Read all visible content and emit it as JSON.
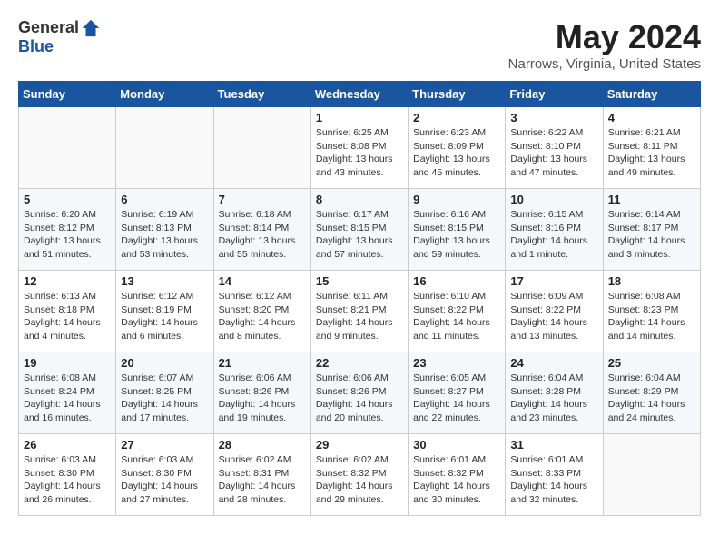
{
  "header": {
    "logo_general": "General",
    "logo_blue": "Blue",
    "month_title": "May 2024",
    "location": "Narrows, Virginia, United States"
  },
  "calendar": {
    "days_of_week": [
      "Sunday",
      "Monday",
      "Tuesday",
      "Wednesday",
      "Thursday",
      "Friday",
      "Saturday"
    ],
    "weeks": [
      [
        {
          "day": "",
          "info": ""
        },
        {
          "day": "",
          "info": ""
        },
        {
          "day": "",
          "info": ""
        },
        {
          "day": "1",
          "info": "Sunrise: 6:25 AM\nSunset: 8:08 PM\nDaylight: 13 hours\nand 43 minutes."
        },
        {
          "day": "2",
          "info": "Sunrise: 6:23 AM\nSunset: 8:09 PM\nDaylight: 13 hours\nand 45 minutes."
        },
        {
          "day": "3",
          "info": "Sunrise: 6:22 AM\nSunset: 8:10 PM\nDaylight: 13 hours\nand 47 minutes."
        },
        {
          "day": "4",
          "info": "Sunrise: 6:21 AM\nSunset: 8:11 PM\nDaylight: 13 hours\nand 49 minutes."
        }
      ],
      [
        {
          "day": "5",
          "info": "Sunrise: 6:20 AM\nSunset: 8:12 PM\nDaylight: 13 hours\nand 51 minutes."
        },
        {
          "day": "6",
          "info": "Sunrise: 6:19 AM\nSunset: 8:13 PM\nDaylight: 13 hours\nand 53 minutes."
        },
        {
          "day": "7",
          "info": "Sunrise: 6:18 AM\nSunset: 8:14 PM\nDaylight: 13 hours\nand 55 minutes."
        },
        {
          "day": "8",
          "info": "Sunrise: 6:17 AM\nSunset: 8:15 PM\nDaylight: 13 hours\nand 57 minutes."
        },
        {
          "day": "9",
          "info": "Sunrise: 6:16 AM\nSunset: 8:15 PM\nDaylight: 13 hours\nand 59 minutes."
        },
        {
          "day": "10",
          "info": "Sunrise: 6:15 AM\nSunset: 8:16 PM\nDaylight: 14 hours\nand 1 minute."
        },
        {
          "day": "11",
          "info": "Sunrise: 6:14 AM\nSunset: 8:17 PM\nDaylight: 14 hours\nand 3 minutes."
        }
      ],
      [
        {
          "day": "12",
          "info": "Sunrise: 6:13 AM\nSunset: 8:18 PM\nDaylight: 14 hours\nand 4 minutes."
        },
        {
          "day": "13",
          "info": "Sunrise: 6:12 AM\nSunset: 8:19 PM\nDaylight: 14 hours\nand 6 minutes."
        },
        {
          "day": "14",
          "info": "Sunrise: 6:12 AM\nSunset: 8:20 PM\nDaylight: 14 hours\nand 8 minutes."
        },
        {
          "day": "15",
          "info": "Sunrise: 6:11 AM\nSunset: 8:21 PM\nDaylight: 14 hours\nand 9 minutes."
        },
        {
          "day": "16",
          "info": "Sunrise: 6:10 AM\nSunset: 8:22 PM\nDaylight: 14 hours\nand 11 minutes."
        },
        {
          "day": "17",
          "info": "Sunrise: 6:09 AM\nSunset: 8:22 PM\nDaylight: 14 hours\nand 13 minutes."
        },
        {
          "day": "18",
          "info": "Sunrise: 6:08 AM\nSunset: 8:23 PM\nDaylight: 14 hours\nand 14 minutes."
        }
      ],
      [
        {
          "day": "19",
          "info": "Sunrise: 6:08 AM\nSunset: 8:24 PM\nDaylight: 14 hours\nand 16 minutes."
        },
        {
          "day": "20",
          "info": "Sunrise: 6:07 AM\nSunset: 8:25 PM\nDaylight: 14 hours\nand 17 minutes."
        },
        {
          "day": "21",
          "info": "Sunrise: 6:06 AM\nSunset: 8:26 PM\nDaylight: 14 hours\nand 19 minutes."
        },
        {
          "day": "22",
          "info": "Sunrise: 6:06 AM\nSunset: 8:26 PM\nDaylight: 14 hours\nand 20 minutes."
        },
        {
          "day": "23",
          "info": "Sunrise: 6:05 AM\nSunset: 8:27 PM\nDaylight: 14 hours\nand 22 minutes."
        },
        {
          "day": "24",
          "info": "Sunrise: 6:04 AM\nSunset: 8:28 PM\nDaylight: 14 hours\nand 23 minutes."
        },
        {
          "day": "25",
          "info": "Sunrise: 6:04 AM\nSunset: 8:29 PM\nDaylight: 14 hours\nand 24 minutes."
        }
      ],
      [
        {
          "day": "26",
          "info": "Sunrise: 6:03 AM\nSunset: 8:30 PM\nDaylight: 14 hours\nand 26 minutes."
        },
        {
          "day": "27",
          "info": "Sunrise: 6:03 AM\nSunset: 8:30 PM\nDaylight: 14 hours\nand 27 minutes."
        },
        {
          "day": "28",
          "info": "Sunrise: 6:02 AM\nSunset: 8:31 PM\nDaylight: 14 hours\nand 28 minutes."
        },
        {
          "day": "29",
          "info": "Sunrise: 6:02 AM\nSunset: 8:32 PM\nDaylight: 14 hours\nand 29 minutes."
        },
        {
          "day": "30",
          "info": "Sunrise: 6:01 AM\nSunset: 8:32 PM\nDaylight: 14 hours\nand 30 minutes."
        },
        {
          "day": "31",
          "info": "Sunrise: 6:01 AM\nSunset: 8:33 PM\nDaylight: 14 hours\nand 32 minutes."
        },
        {
          "day": "",
          "info": ""
        }
      ]
    ]
  }
}
